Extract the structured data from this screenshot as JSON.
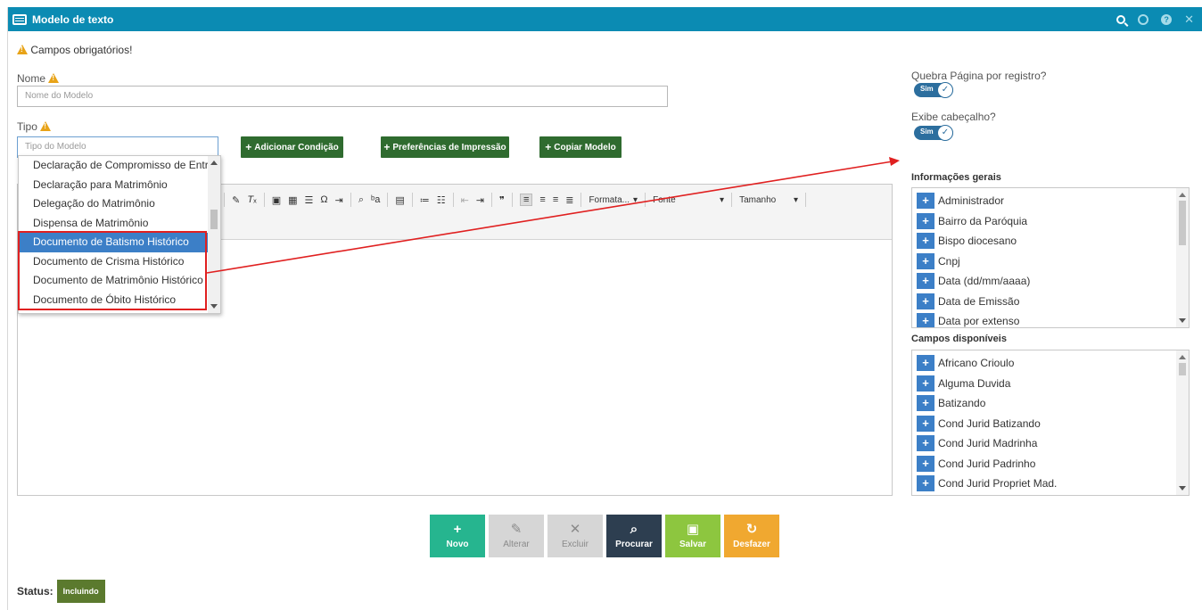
{
  "window": {
    "title": "Modelo de texto"
  },
  "form": {
    "required_notice": "Campos obrigatórios!",
    "nome_label": "Nome",
    "nome_placeholder": "Nome do Modelo",
    "tipo_label": "Tipo",
    "tipo_placeholder": "Tipo do Modelo"
  },
  "buttons": {
    "adicionar_condicao": "Adicionar Condição",
    "preferencias_impressao": "Preferências de Impressão",
    "copiar_modelo": "Copiar Modelo"
  },
  "dropdown": {
    "items": [
      "Declaração de Compromisso de Entrega",
      "Declaração para Matrimônio",
      "Delegação do Matrimônio",
      "Dispensa de Matrimônio",
      "Documento de Batismo Histórico",
      "Documento de Crisma Histórico",
      "Documento de Matrimônio Histórico",
      "Documento de Óbito Histórico"
    ],
    "selected_index": 4
  },
  "editor_toolbar": {
    "format_label": "Formata...",
    "font_label": "Fonte",
    "size_label": "Tamanho"
  },
  "options": {
    "quebra_label": "Quebra Página por registro?",
    "quebra_value": "Sim",
    "cabecalho_label": "Exibe cabeçalho?",
    "cabecalho_value": "Sim"
  },
  "info_gerais": {
    "title": "Informações gerais",
    "items": [
      "Administrador",
      "Bairro da Paróquia",
      "Bispo diocesano",
      "Cnpj",
      "Data (dd/mm/aaaa)",
      "Data de Emissão",
      "Data por extenso"
    ]
  },
  "campos_disponiveis": {
    "title": "Campos disponíveis",
    "items": [
      "Africano Crioulo",
      "Alguma Duvida",
      "Batizando",
      "Cond Jurid Batizando",
      "Cond Jurid Madrinha",
      "Cond Jurid Padrinho",
      "Cond Jurid Propriet Mad."
    ]
  },
  "actions": [
    {
      "label": "Novo",
      "icon": "+",
      "color": "#26b58f",
      "enabled": true
    },
    {
      "label": "Alterar",
      "icon": "✎",
      "color": "#d6d6d6",
      "enabled": false
    },
    {
      "label": "Excluir",
      "icon": "✕",
      "color": "#d6d6d6",
      "enabled": false
    },
    {
      "label": "Procurar",
      "icon": "⌕",
      "color": "#2d3e50",
      "enabled": true
    },
    {
      "label": "Salvar",
      "icon": "▣",
      "color": "#8dc63f",
      "enabled": true
    },
    {
      "label": "Desfazer",
      "icon": "↻",
      "color": "#f0a830",
      "enabled": true
    }
  ],
  "status": {
    "label": "Status:",
    "value": "Incluindo"
  },
  "colors": {
    "titlebar": "#0b8bb3",
    "green_button": "#2f6b2f",
    "selected_item": "#3c7fc7",
    "highlight_red": "#e02020"
  }
}
